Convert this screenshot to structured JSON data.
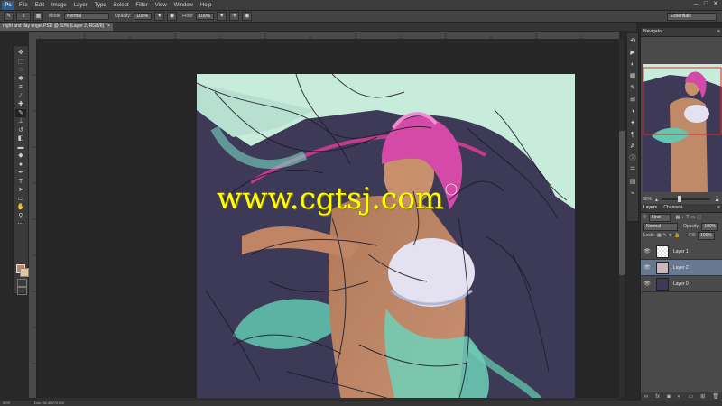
{
  "app": {
    "logo": "Ps"
  },
  "menu": [
    "File",
    "Edit",
    "Image",
    "Layer",
    "Type",
    "Select",
    "Filter",
    "View",
    "Window",
    "Help"
  ],
  "options_bar": {
    "brush_size": "9",
    "mode_label": "Mode:",
    "mode_value": "Normal",
    "opacity_label": "Opacity:",
    "opacity_value": "100%",
    "flow_label": "Flow:",
    "flow_value": "100%",
    "workspace": "Essentials"
  },
  "document": {
    "tab_title": "night and day angel.PSD @ 50% (Layer 2, RGB/8) *",
    "close": "×"
  },
  "status": {
    "zoom": "50%",
    "doc": "Doc: 34.4M/70.6M"
  },
  "navigator": {
    "title": "Navigator",
    "zoom": "50%"
  },
  "layers": {
    "tabs": [
      "Layers",
      "Channels"
    ],
    "kind_label": "Kind",
    "blend_mode": "Normal",
    "opacity_label": "Opacity:",
    "opacity_value": "100%",
    "lock_label": "Lock:",
    "fill_label": "Fill:",
    "fill_value": "100%",
    "items": [
      {
        "name": "Layer 1",
        "selected": false
      },
      {
        "name": "Layer 2",
        "selected": true
      },
      {
        "name": "Layer 0",
        "selected": false
      }
    ]
  },
  "watermark": "www.cgtsj.com",
  "colors": {
    "foreground": "#c5806a",
    "background": "#e0c8a0",
    "selection": "#687890"
  }
}
